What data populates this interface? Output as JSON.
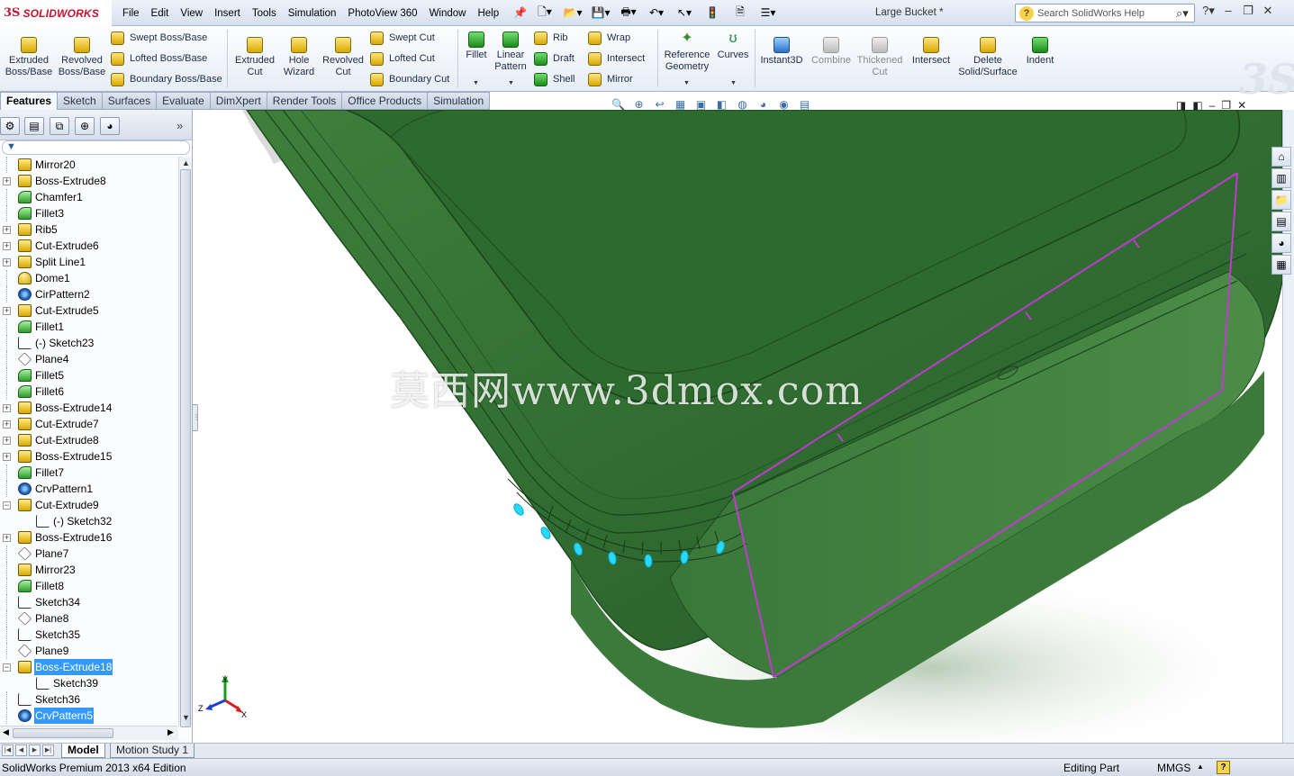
{
  "app": {
    "logo": "SOLIDWORKS",
    "document_title": "Large Bucket *"
  },
  "menu": [
    "File",
    "Edit",
    "View",
    "Insert",
    "Tools",
    "Simulation",
    "PhotoView 360",
    "Window",
    "Help"
  ],
  "search": {
    "placeholder": "Search SolidWorks Help"
  },
  "commands": {
    "extruded_boss": "Extruded\nBoss/Base",
    "revolved_boss": "Revolved\nBoss/Base",
    "swept_boss": "Swept Boss/Base",
    "lofted_boss": "Lofted Boss/Base",
    "boundary_boss": "Boundary Boss/Base",
    "extruded_cut": "Extruded\nCut",
    "hole_wizard": "Hole\nWizard",
    "revolved_cut": "Revolved\nCut",
    "swept_cut": "Swept Cut",
    "lofted_cut": "Lofted Cut",
    "boundary_cut": "Boundary Cut",
    "fillet": "Fillet",
    "linear_pattern": "Linear\nPattern",
    "rib": "Rib",
    "draft": "Draft",
    "shell": "Shell",
    "wrap": "Wrap",
    "intersect_small": "Intersect",
    "mirror": "Mirror",
    "reference_geometry": "Reference\nGeometry",
    "curves": "Curves",
    "instant3d": "Instant3D",
    "combine": "Combine",
    "thickened_cut": "Thickened\nCut",
    "intersect": "Intersect",
    "delete_solid": "Delete\nSolid/Surface",
    "indent": "Indent"
  },
  "tabs": [
    "Features",
    "Sketch",
    "Surfaces",
    "Evaluate",
    "DimXpert",
    "Render Tools",
    "Office Products",
    "Simulation"
  ],
  "active_tab": "Features",
  "feature_tree": [
    {
      "label": "Mirror20",
      "icon": "feature",
      "expandable": false,
      "indent": 0,
      "selected": false
    },
    {
      "label": "Boss-Extrude8",
      "icon": "feature",
      "expandable": true,
      "indent": 0,
      "selected": false
    },
    {
      "label": "Chamfer1",
      "icon": "fillet",
      "expandable": false,
      "indent": 0,
      "selected": false
    },
    {
      "label": "Fillet3",
      "icon": "fillet",
      "expandable": false,
      "indent": 0,
      "selected": false
    },
    {
      "label": "Rib5",
      "icon": "feature",
      "expandable": true,
      "indent": 0,
      "selected": false
    },
    {
      "label": "Cut-Extrude6",
      "icon": "feature",
      "expandable": true,
      "indent": 0,
      "selected": false
    },
    {
      "label": "Split Line1",
      "icon": "feature",
      "expandable": true,
      "indent": 0,
      "selected": false
    },
    {
      "label": "Dome1",
      "icon": "dome",
      "expandable": false,
      "indent": 0,
      "selected": false
    },
    {
      "label": "CirPattern2",
      "icon": "pattern",
      "expandable": false,
      "indent": 0,
      "selected": false
    },
    {
      "label": "Cut-Extrude5",
      "icon": "feature",
      "expandable": true,
      "indent": 0,
      "selected": false
    },
    {
      "label": "Fillet1",
      "icon": "fillet",
      "expandable": false,
      "indent": 0,
      "selected": false
    },
    {
      "label": "(-) Sketch23",
      "icon": "sketch",
      "expandable": false,
      "indent": 0,
      "selected": false
    },
    {
      "label": "Plane4",
      "icon": "plane",
      "expandable": false,
      "indent": 0,
      "selected": false
    },
    {
      "label": "Fillet5",
      "icon": "fillet",
      "expandable": false,
      "indent": 0,
      "selected": false
    },
    {
      "label": "Fillet6",
      "icon": "fillet",
      "expandable": false,
      "indent": 0,
      "selected": false
    },
    {
      "label": "Boss-Extrude14",
      "icon": "feature",
      "expandable": true,
      "indent": 0,
      "selected": false
    },
    {
      "label": "Cut-Extrude7",
      "icon": "feature",
      "expandable": true,
      "indent": 0,
      "selected": false
    },
    {
      "label": "Cut-Extrude8",
      "icon": "feature",
      "expandable": true,
      "indent": 0,
      "selected": false
    },
    {
      "label": "Boss-Extrude15",
      "icon": "feature",
      "expandable": true,
      "indent": 0,
      "selected": false
    },
    {
      "label": "Fillet7",
      "icon": "fillet",
      "expandable": false,
      "indent": 0,
      "selected": false
    },
    {
      "label": "CrvPattern1",
      "icon": "pattern",
      "expandable": false,
      "indent": 0,
      "selected": false
    },
    {
      "label": "Cut-Extrude9",
      "icon": "feature",
      "expandable": true,
      "expanded": true,
      "indent": 0,
      "selected": false
    },
    {
      "label": "(-) Sketch32",
      "icon": "sketch",
      "expandable": false,
      "indent": 1,
      "selected": false
    },
    {
      "label": "Boss-Extrude16",
      "icon": "feature",
      "expandable": true,
      "indent": 0,
      "selected": false
    },
    {
      "label": "Plane7",
      "icon": "plane",
      "expandable": false,
      "indent": 0,
      "selected": false
    },
    {
      "label": "Mirror23",
      "icon": "feature",
      "expandable": false,
      "indent": 0,
      "selected": false
    },
    {
      "label": "Fillet8",
      "icon": "fillet",
      "expandable": false,
      "indent": 0,
      "selected": false
    },
    {
      "label": "Sketch34",
      "icon": "sketch",
      "expandable": false,
      "indent": 0,
      "selected": false
    },
    {
      "label": "Plane8",
      "icon": "plane",
      "expandable": false,
      "indent": 0,
      "selected": false
    },
    {
      "label": "Sketch35",
      "icon": "sketch",
      "expandable": false,
      "indent": 0,
      "selected": false
    },
    {
      "label": "Plane9",
      "icon": "plane",
      "expandable": false,
      "indent": 0,
      "selected": false
    },
    {
      "label": "Boss-Extrude18",
      "icon": "feature",
      "expandable": true,
      "expanded": true,
      "indent": 0,
      "selected": true
    },
    {
      "label": "Sketch39",
      "icon": "sketch",
      "expandable": false,
      "indent": 1,
      "selected": false
    },
    {
      "label": "Sketch36",
      "icon": "sketch",
      "expandable": false,
      "indent": 0,
      "selected": false
    },
    {
      "label": "CrvPattern5",
      "icon": "pattern",
      "expandable": false,
      "indent": 0,
      "selected": true
    }
  ],
  "watermark": "莫西网www.3dmox.com",
  "bottom_tabs": [
    "Model",
    "Motion Study 1"
  ],
  "status": {
    "edition": "SolidWorks Premium 2013 x64 Edition",
    "mode": "Editing Part",
    "units": "MMGS"
  },
  "colors": {
    "model_green": "#2f6b30",
    "model_green_light": "#4f8f48",
    "edge_purple": "#c03ad0",
    "highlight_cyan": "#28d8ff",
    "selection_blue": "#3399ff"
  },
  "icons": {
    "triad": "coordinate-triad-icon"
  }
}
